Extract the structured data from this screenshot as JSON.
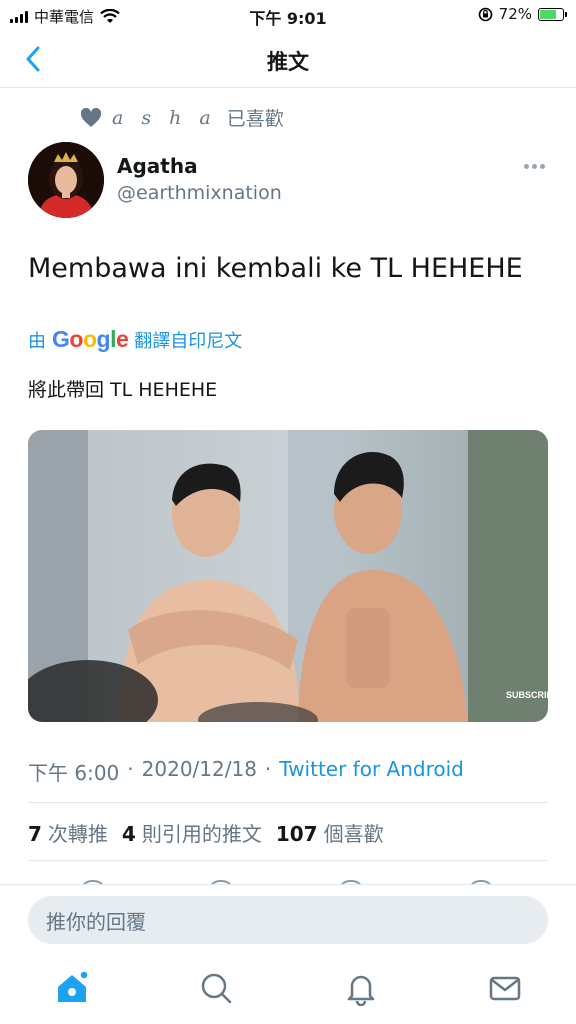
{
  "status_bar": {
    "carrier": "中華電信",
    "time": "下午 9:01",
    "battery": "72%",
    "battery_level": 0.72
  },
  "header": {
    "title": "推文"
  },
  "social_context": {
    "liker": "a s h a",
    "action": "已喜歡"
  },
  "tweet": {
    "author_name": "Agatha",
    "author_handle": "@earthmixnation",
    "text": "Membawa ini kembali ke TL HEHEHE",
    "translate_prefix": "由",
    "translate_brand": "Google",
    "translate_suffix": "翻譯自印尼文",
    "translated_text": "將此帶回 TL HEHEHE",
    "media_watermark": "SUBSCRIBE",
    "time": "下午 6:00",
    "date": "2020/12/18",
    "source": "Twitter for Android",
    "separator": "·"
  },
  "stats": {
    "retweets_count": "7",
    "retweets_label": "次轉推",
    "quotes_count": "4",
    "quotes_label": "則引用的推文",
    "likes_count": "107",
    "likes_label": "個喜歡"
  },
  "reply": {
    "placeholder": "推你的回覆"
  },
  "colors": {
    "accent": "#1da1f2",
    "link": "#1b95e0",
    "secondary_text": "#657786",
    "divider": "#e1e8ed"
  },
  "tabs": [
    "home-icon",
    "search-icon",
    "bell-icon",
    "mail-icon"
  ]
}
